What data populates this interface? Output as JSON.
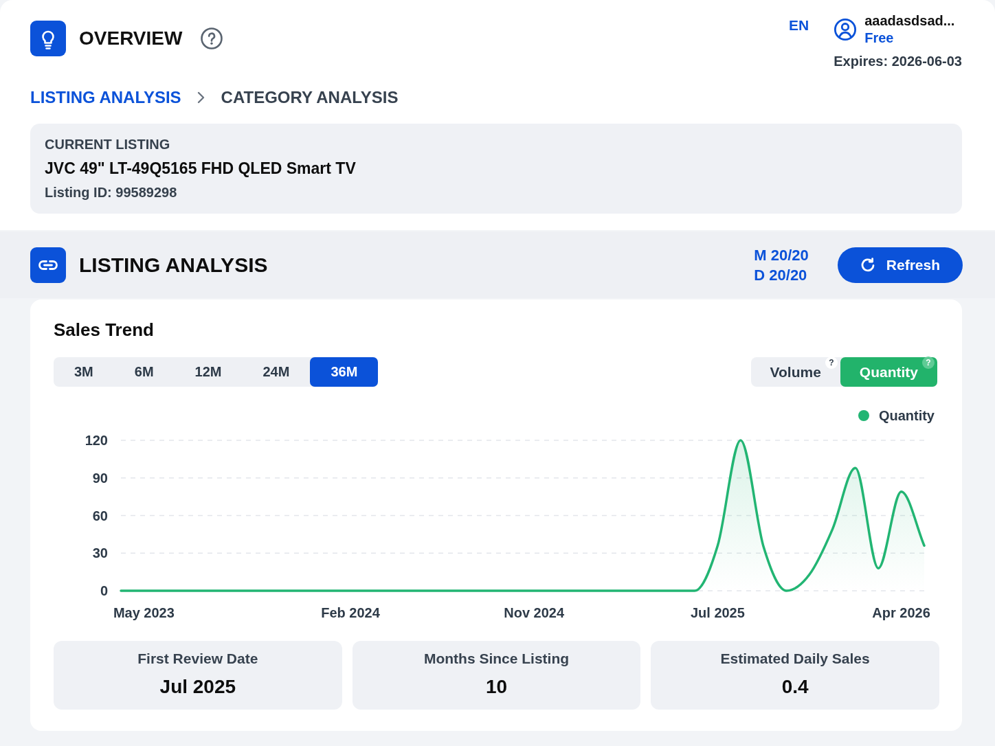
{
  "header": {
    "title": "OVERVIEW",
    "language": {
      "label": "EN",
      "selected": true
    },
    "user": {
      "name": "aaadasdsad...",
      "plan": "Free",
      "expires": "Expires: 2026-06-03"
    }
  },
  "breadcrumb": [
    {
      "label": "LISTING ANALYSIS",
      "selected": true
    },
    {
      "label": "CATEGORY ANALYSIS",
      "selected": false
    }
  ],
  "current_listing": {
    "label": "CURRENT LISTING",
    "title": "JVC 49\" LT-49Q5165 FHD QLED Smart TV",
    "listing_id": "Listing ID: 99589298"
  },
  "section": {
    "title": "LISTING ANALYSIS",
    "quota": [
      "M 20/20",
      "D 20/20"
    ],
    "refresh_button": "Refresh"
  },
  "sales_trend": {
    "title": "Sales Trend",
    "periods": [
      {
        "label": "3M",
        "selected": false
      },
      {
        "label": "6M",
        "selected": false
      },
      {
        "label": "12M",
        "selected": false
      },
      {
        "label": "24M",
        "selected": false
      },
      {
        "label": "36M",
        "selected": true
      }
    ],
    "metrics": [
      {
        "label": "Volume",
        "selected": false,
        "help": "?"
      },
      {
        "label": "Quantity",
        "selected": true,
        "help": "?"
      }
    ],
    "chart_data": {
      "type": "area",
      "categories": [
        null,
        "May 2023",
        null,
        null,
        null,
        null,
        null,
        null,
        null,
        null,
        "Feb 2024",
        null,
        null,
        null,
        null,
        null,
        null,
        null,
        "Nov 2024",
        null,
        null,
        null,
        null,
        null,
        null,
        null,
        "Jul 2025",
        null,
        null,
        null,
        null,
        null,
        null,
        null,
        "Apr 2026",
        null
      ],
      "series": [
        {
          "name": "Quantity",
          "color": "#22b573",
          "values": [
            0,
            0,
            0,
            0,
            0,
            0,
            0,
            0,
            0,
            0,
            0,
            0,
            0,
            0,
            0,
            0,
            0,
            0,
            0,
            0,
            0,
            0,
            0,
            0,
            0,
            0,
            36,
            120,
            35,
            0,
            13,
            49,
            98,
            18,
            79,
            36
          ]
        }
      ],
      "ylim": [
        0,
        120
      ],
      "yticks": [
        0,
        30,
        60,
        90,
        120
      ],
      "grid": true
    }
  },
  "stats": [
    {
      "label": "First Review Date",
      "value": "Jul 2025"
    },
    {
      "label": "Months Since Listing",
      "value": "10"
    },
    {
      "label": "Estimated Daily Sales",
      "value": "0.4"
    }
  ]
}
